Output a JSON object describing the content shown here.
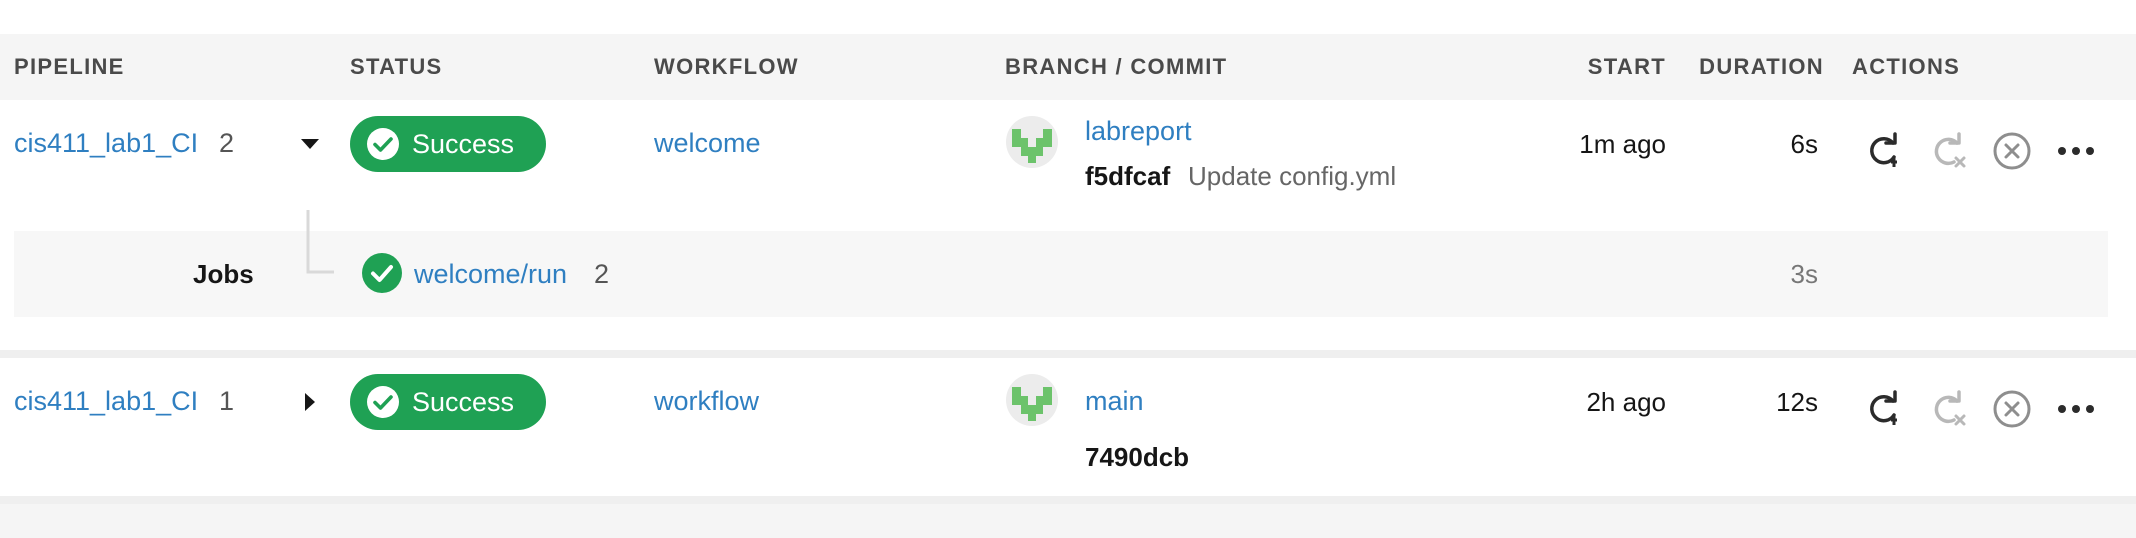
{
  "columns": {
    "pipeline": "PIPELINE",
    "status": "STATUS",
    "workflow": "WORKFLOW",
    "branch_commit": "BRANCH / COMMIT",
    "start": "START",
    "duration": "DURATION",
    "actions": "ACTIONS"
  },
  "pipelines": [
    {
      "name": "cis411_lab1_CI",
      "number": "2",
      "expanded": true,
      "status": "Success",
      "workflow": "welcome",
      "branch": "labreport",
      "commit_sha": "f5dfcaf",
      "commit_message": "Update config.yml",
      "start": "1m ago",
      "duration": "6s",
      "jobs_label": "Jobs",
      "jobs": [
        {
          "name": "welcome/run",
          "number": "2",
          "duration": "3s"
        }
      ]
    },
    {
      "name": "cis411_lab1_CI",
      "number": "1",
      "expanded": false,
      "status": "Success",
      "workflow": "workflow",
      "branch": "main",
      "commit_sha": "7490dcb",
      "commit_message": "",
      "start": "2h ago",
      "duration": "12s"
    }
  ],
  "icons": {
    "status": "check-circle-icon",
    "expand_open": "caret-down-icon",
    "expand_closed": "caret-right-icon",
    "rerun": "rerun-icon",
    "rerun_failed": "rerun-failed-icon",
    "cancel": "cancel-icon",
    "more": "more-icon",
    "avatar": "user-avatar-identicon"
  },
  "colors": {
    "success": "#1fa154",
    "link": "#2f7fc1",
    "header_bg": "#f5f5f5",
    "jobs_bg": "#f7f7f7",
    "avatar_green": "#6cc36b"
  }
}
